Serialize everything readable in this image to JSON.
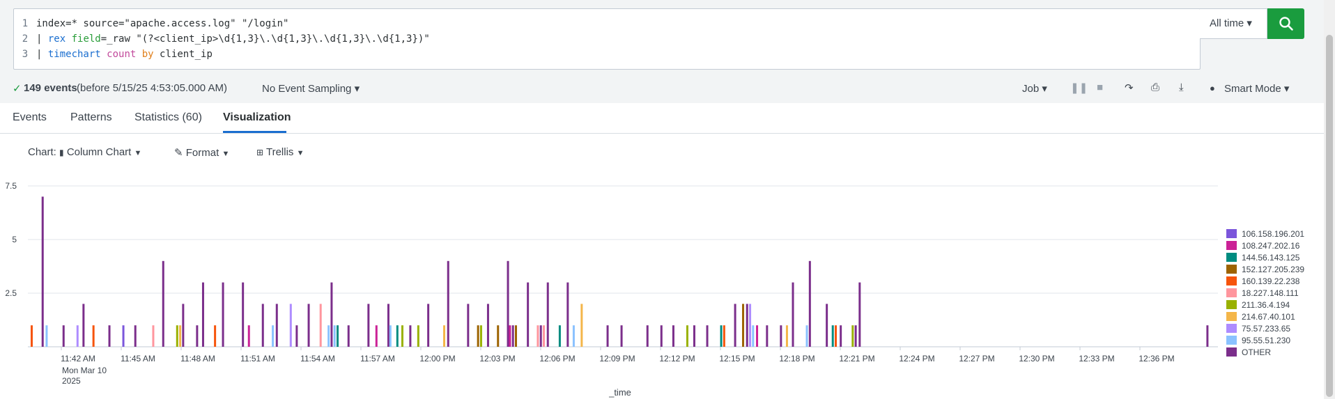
{
  "query": {
    "lines": [
      {
        "num": "1",
        "segments": [
          {
            "t": "index=* source=\"apache.access.log\" \"/login\"",
            "c": "qtext"
          }
        ]
      },
      {
        "num": "2",
        "segments": [
          {
            "t": "| ",
            "c": "qtext"
          },
          {
            "t": "rex",
            "c": "q-cmd"
          },
          {
            "t": " ",
            "c": "qtext"
          },
          {
            "t": "field",
            "c": "q-arg"
          },
          {
            "t": "=_raw \"(?<client_ip>\\d{1,3}\\.\\d{1,3}\\.\\d{1,3}\\.\\d{1,3})\"",
            "c": "qtext"
          }
        ]
      },
      {
        "num": "3",
        "segments": [
          {
            "t": "| ",
            "c": "qtext"
          },
          {
            "t": "timechart",
            "c": "q-cmd"
          },
          {
            "t": " ",
            "c": "qtext"
          },
          {
            "t": "count",
            "c": "q-fn"
          },
          {
            "t": " ",
            "c": "qtext"
          },
          {
            "t": "by",
            "c": "q-kw"
          },
          {
            "t": " client_ip",
            "c": "qtext"
          }
        ]
      }
    ]
  },
  "time_picker": {
    "label": "All time ▾"
  },
  "status": {
    "events": "149 events",
    "before": "(before 5/15/25 4:53:05.000 AM)",
    "sampling": "No Event Sampling ▾",
    "job": "Job ▾",
    "smart_mode": "Smart Mode ▾"
  },
  "tabs": [
    {
      "label": "Events",
      "active": false
    },
    {
      "label": "Patterns",
      "active": false
    },
    {
      "label": "Statistics (60)",
      "active": false
    },
    {
      "label": "Visualization",
      "active": true
    }
  ],
  "chart_toolbar": {
    "chart_label": "Chart:",
    "chart_type": "Column Chart",
    "format": "Format",
    "trellis": "Trellis"
  },
  "chart_data": {
    "type": "bar",
    "xlabel": "_time",
    "ylabel": "",
    "ylim": [
      0,
      7.5
    ],
    "yticks": [
      "7.5",
      "5",
      "2.5"
    ],
    "xticks": [
      "11:42 AM",
      "11:45 AM",
      "11:48 AM",
      "11:51 AM",
      "11:54 AM",
      "11:57 AM",
      "12:00 PM",
      "12:03 PM",
      "12:06 PM",
      "12:09 PM",
      "12:12 PM",
      "12:15 PM",
      "12:18 PM",
      "12:21 PM",
      "12:24 PM",
      "12:27 PM",
      "12:30 PM",
      "12:33 PM",
      "12:36 PM"
    ],
    "first_tick_sub": [
      "Mon Mar 10",
      "2025"
    ],
    "legend_position": "right",
    "series": [
      {
        "name": "106.158.196.201",
        "color": "#7b56db"
      },
      {
        "name": "108.247.202.16",
        "color": "#cb2196"
      },
      {
        "name": "144.56.143.125",
        "color": "#008c80"
      },
      {
        "name": "152.127.205.239",
        "color": "#9d6300"
      },
      {
        "name": "160.139.22.238",
        "color": "#f6540b"
      },
      {
        "name": "18.227.148.111",
        "color": "#ff969e"
      },
      {
        "name": "211.36.4.194",
        "color": "#99b100"
      },
      {
        "name": "214.67.40.101",
        "color": "#f4b649"
      },
      {
        "name": "75.57.233.65",
        "color": "#ae8cff"
      },
      {
        "name": "95.55.51.230",
        "color": "#8ac2ff"
      },
      {
        "name": "OTHER",
        "color": "#7b2e8b"
      }
    ],
    "bars": [
      {
        "x": 0.0,
        "s": 4,
        "v": 1
      },
      {
        "x": 0.55,
        "s": 10,
        "v": 7
      },
      {
        "x": 0.75,
        "s": 9,
        "v": 1
      },
      {
        "x": 1.6,
        "s": 10,
        "v": 1
      },
      {
        "x": 2.3,
        "s": 8,
        "v": 1
      },
      {
        "x": 2.6,
        "s": 10,
        "v": 2
      },
      {
        "x": 3.1,
        "s": 4,
        "v": 1
      },
      {
        "x": 3.9,
        "s": 10,
        "v": 1
      },
      {
        "x": 4.6,
        "s": 0,
        "v": 1
      },
      {
        "x": 5.2,
        "s": 10,
        "v": 1
      },
      {
        "x": 6.1,
        "s": 5,
        "v": 1
      },
      {
        "x": 6.6,
        "s": 10,
        "v": 4
      },
      {
        "x": 7.3,
        "s": 6,
        "v": 1
      },
      {
        "x": 7.45,
        "s": 7,
        "v": 1
      },
      {
        "x": 7.6,
        "s": 10,
        "v": 2
      },
      {
        "x": 8.3,
        "s": 10,
        "v": 1
      },
      {
        "x": 8.6,
        "s": 10,
        "v": 3
      },
      {
        "x": 9.2,
        "s": 4,
        "v": 1
      },
      {
        "x": 9.6,
        "s": 10,
        "v": 3
      },
      {
        "x": 10.6,
        "s": 10,
        "v": 3
      },
      {
        "x": 10.9,
        "s": 1,
        "v": 1
      },
      {
        "x": 11.6,
        "s": 10,
        "v": 2
      },
      {
        "x": 12.1,
        "s": 9,
        "v": 1
      },
      {
        "x": 12.3,
        "s": 10,
        "v": 2
      },
      {
        "x": 13.0,
        "s": 8,
        "v": 2
      },
      {
        "x": 13.3,
        "s": 10,
        "v": 1
      },
      {
        "x": 13.9,
        "s": 10,
        "v": 2
      },
      {
        "x": 14.5,
        "s": 5,
        "v": 2
      },
      {
        "x": 14.9,
        "s": 9,
        "v": 1
      },
      {
        "x": 15.05,
        "s": 10,
        "v": 3
      },
      {
        "x": 15.2,
        "s": 9,
        "v": 1
      },
      {
        "x": 15.35,
        "s": 2,
        "v": 1
      },
      {
        "x": 15.9,
        "s": 10,
        "v": 1
      },
      {
        "x": 16.9,
        "s": 10,
        "v": 2
      },
      {
        "x": 17.3,
        "s": 1,
        "v": 1
      },
      {
        "x": 17.9,
        "s": 10,
        "v": 2
      },
      {
        "x": 18.0,
        "s": 9,
        "v": 1
      },
      {
        "x": 18.35,
        "s": 2,
        "v": 1
      },
      {
        "x": 18.6,
        "s": 6,
        "v": 1
      },
      {
        "x": 19.0,
        "s": 10,
        "v": 1
      },
      {
        "x": 19.4,
        "s": 6,
        "v": 1
      },
      {
        "x": 19.9,
        "s": 10,
        "v": 2
      },
      {
        "x": 20.7,
        "s": 7,
        "v": 1
      },
      {
        "x": 20.9,
        "s": 10,
        "v": 4
      },
      {
        "x": 21.9,
        "s": 10,
        "v": 2
      },
      {
        "x": 22.4,
        "s": 3,
        "v": 1
      },
      {
        "x": 22.55,
        "s": 6,
        "v": 1
      },
      {
        "x": 22.9,
        "s": 10,
        "v": 2
      },
      {
        "x": 23.4,
        "s": 3,
        "v": 1
      },
      {
        "x": 23.9,
        "s": 10,
        "v": 4
      },
      {
        "x": 24.0,
        "s": 1,
        "v": 1
      },
      {
        "x": 24.15,
        "s": 10,
        "v": 1
      },
      {
        "x": 24.3,
        "s": 3,
        "v": 1
      },
      {
        "x": 24.9,
        "s": 10,
        "v": 3
      },
      {
        "x": 25.4,
        "s": 5,
        "v": 1
      },
      {
        "x": 25.55,
        "s": 10,
        "v": 1
      },
      {
        "x": 25.7,
        "s": 5,
        "v": 1
      },
      {
        "x": 25.9,
        "s": 10,
        "v": 3
      },
      {
        "x": 26.5,
        "s": 2,
        "v": 1
      },
      {
        "x": 26.9,
        "s": 10,
        "v": 3
      },
      {
        "x": 27.2,
        "s": 9,
        "v": 1
      },
      {
        "x": 27.6,
        "s": 7,
        "v": 2
      },
      {
        "x": 28.9,
        "s": 10,
        "v": 1
      },
      {
        "x": 29.6,
        "s": 10,
        "v": 1
      },
      {
        "x": 30.9,
        "s": 10,
        "v": 1
      },
      {
        "x": 31.6,
        "s": 10,
        "v": 1
      },
      {
        "x": 32.2,
        "s": 10,
        "v": 1
      },
      {
        "x": 32.9,
        "s": 6,
        "v": 1
      },
      {
        "x": 33.25,
        "s": 10,
        "v": 1
      },
      {
        "x": 33.9,
        "s": 10,
        "v": 1
      },
      {
        "x": 34.6,
        "s": 2,
        "v": 1
      },
      {
        "x": 34.75,
        "s": 4,
        "v": 1
      },
      {
        "x": 35.3,
        "s": 10,
        "v": 2
      },
      {
        "x": 35.7,
        "s": 3,
        "v": 2
      },
      {
        "x": 35.9,
        "s": 10,
        "v": 2
      },
      {
        "x": 36.05,
        "s": 8,
        "v": 2
      },
      {
        "x": 36.2,
        "s": 9,
        "v": 1
      },
      {
        "x": 36.4,
        "s": 1,
        "v": 1
      },
      {
        "x": 36.9,
        "s": 10,
        "v": 1
      },
      {
        "x": 37.6,
        "s": 10,
        "v": 1
      },
      {
        "x": 37.9,
        "s": 7,
        "v": 1
      },
      {
        "x": 38.2,
        "s": 10,
        "v": 3
      },
      {
        "x": 38.9,
        "s": 9,
        "v": 1
      },
      {
        "x": 39.05,
        "s": 10,
        "v": 4
      },
      {
        "x": 39.9,
        "s": 10,
        "v": 2
      },
      {
        "x": 40.2,
        "s": 2,
        "v": 1
      },
      {
        "x": 40.35,
        "s": 4,
        "v": 1
      },
      {
        "x": 40.6,
        "s": 10,
        "v": 1
      },
      {
        "x": 41.2,
        "s": 6,
        "v": 1
      },
      {
        "x": 41.35,
        "s": 10,
        "v": 1
      },
      {
        "x": 41.55,
        "s": 10,
        "v": 3
      },
      {
        "x": 59.0,
        "s": 10,
        "v": 1
      }
    ]
  }
}
